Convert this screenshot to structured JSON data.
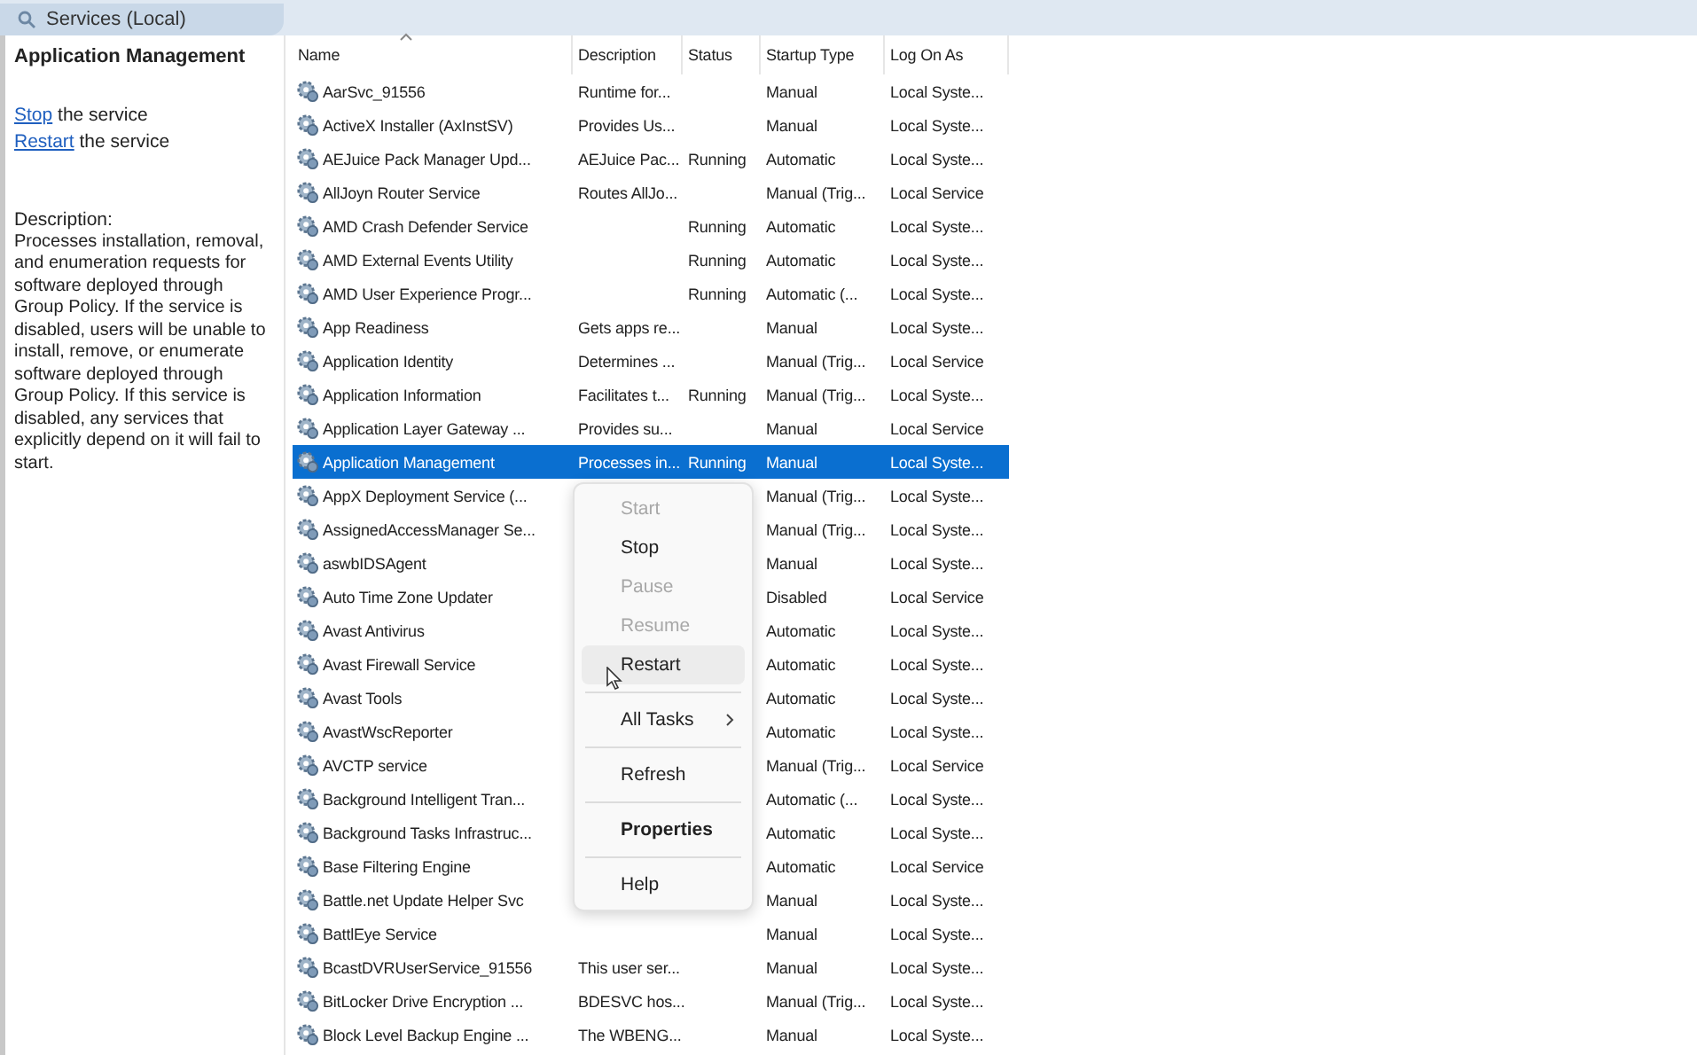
{
  "window": {
    "title": "Services (Local)"
  },
  "details": {
    "title": "Application Management",
    "actions": [
      {
        "link": "Stop",
        "text": "the service"
      },
      {
        "link": "Restart",
        "text": "the service"
      }
    ],
    "description_label": "Description:",
    "description": "Processes installation, removal, and enumeration requests for software deployed through Group Policy. If the service is disabled, users will be unable to install, remove, or enumerate software deployed through Group Policy. If this service is disabled, any services that explicitly depend on it will fail to start."
  },
  "table": {
    "columns": [
      {
        "label": "Name",
        "sorted": true
      },
      {
        "label": "Description",
        "sorted": false
      },
      {
        "label": "Status",
        "sorted": false
      },
      {
        "label": "Startup Type",
        "sorted": false
      },
      {
        "label": "Log On As",
        "sorted": false
      }
    ],
    "rows": [
      {
        "name": "AarSvc_91556",
        "description": "Runtime for...",
        "status": "",
        "startup_type": "Manual",
        "log_on_as": "Local Syste...",
        "selected": false
      },
      {
        "name": "ActiveX Installer (AxInstSV)",
        "description": "Provides Us...",
        "status": "",
        "startup_type": "Manual",
        "log_on_as": "Local Syste...",
        "selected": false
      },
      {
        "name": "AEJuice Pack Manager Upd...",
        "description": "AEJuice Pac...",
        "status": "Running",
        "startup_type": "Automatic",
        "log_on_as": "Local Syste...",
        "selected": false
      },
      {
        "name": "AllJoyn Router Service",
        "description": "Routes AllJo...",
        "status": "",
        "startup_type": "Manual (Trig...",
        "log_on_as": "Local Service",
        "selected": false
      },
      {
        "name": "AMD Crash Defender Service",
        "description": "",
        "status": "Running",
        "startup_type": "Automatic",
        "log_on_as": "Local Syste...",
        "selected": false
      },
      {
        "name": "AMD External Events Utility",
        "description": "",
        "status": "Running",
        "startup_type": "Automatic",
        "log_on_as": "Local Syste...",
        "selected": false
      },
      {
        "name": "AMD User Experience Progr...",
        "description": "",
        "status": "Running",
        "startup_type": "Automatic (...",
        "log_on_as": "Local Syste...",
        "selected": false
      },
      {
        "name": "App Readiness",
        "description": "Gets apps re...",
        "status": "",
        "startup_type": "Manual",
        "log_on_as": "Local Syste...",
        "selected": false
      },
      {
        "name": "Application Identity",
        "description": "Determines ...",
        "status": "",
        "startup_type": "Manual (Trig...",
        "log_on_as": "Local Service",
        "selected": false
      },
      {
        "name": "Application Information",
        "description": "Facilitates t...",
        "status": "Running",
        "startup_type": "Manual (Trig...",
        "log_on_as": "Local Syste...",
        "selected": false
      },
      {
        "name": "Application Layer Gateway ...",
        "description": "Provides su...",
        "status": "",
        "startup_type": "Manual",
        "log_on_as": "Local Service",
        "selected": false
      },
      {
        "name": "Application Management",
        "description": "Processes in...",
        "status": "Running",
        "startup_type": "Manual",
        "log_on_as": "Local Syste...",
        "selected": true
      },
      {
        "name": "AppX Deployment Service (...",
        "description": "",
        "status": "",
        "startup_type": "Manual (Trig...",
        "log_on_as": "Local Syste...",
        "selected": false
      },
      {
        "name": "AssignedAccessManager Se...",
        "description": "",
        "status": "",
        "startup_type": "Manual (Trig...",
        "log_on_as": "Local Syste...",
        "selected": false
      },
      {
        "name": "aswbIDSAgent",
        "description": "",
        "status": "",
        "startup_type": "Manual",
        "log_on_as": "Local Syste...",
        "selected": false
      },
      {
        "name": "Auto Time Zone Updater",
        "description": "",
        "status": "",
        "startup_type": "Disabled",
        "log_on_as": "Local Service",
        "selected": false
      },
      {
        "name": "Avast Antivirus",
        "description": "",
        "status": "",
        "startup_type": "Automatic",
        "log_on_as": "Local Syste...",
        "selected": false
      },
      {
        "name": "Avast Firewall Service",
        "description": "",
        "status": "",
        "startup_type": "Automatic",
        "log_on_as": "Local Syste...",
        "selected": false
      },
      {
        "name": "Avast Tools",
        "description": "",
        "status": "",
        "startup_type": "Automatic",
        "log_on_as": "Local Syste...",
        "selected": false
      },
      {
        "name": "AvastWscReporter",
        "description": "",
        "status": "",
        "startup_type": "Automatic",
        "log_on_as": "Local Syste...",
        "selected": false
      },
      {
        "name": "AVCTP service",
        "description": "",
        "status": "",
        "startup_type": "Manual (Trig...",
        "log_on_as": "Local Service",
        "selected": false
      },
      {
        "name": "Background Intelligent Tran...",
        "description": "",
        "status": "",
        "startup_type": "Automatic (...",
        "log_on_as": "Local Syste...",
        "selected": false
      },
      {
        "name": "Background Tasks Infrastruc...",
        "description": "",
        "status": "",
        "startup_type": "Automatic",
        "log_on_as": "Local Syste...",
        "selected": false
      },
      {
        "name": "Base Filtering Engine",
        "description": "",
        "status": "",
        "startup_type": "Automatic",
        "log_on_as": "Local Service",
        "selected": false
      },
      {
        "name": "Battle.net Update Helper Svc",
        "description": "",
        "status": "",
        "startup_type": "Manual",
        "log_on_as": "Local Syste...",
        "selected": false
      },
      {
        "name": "BattlEye Service",
        "description": "",
        "status": "",
        "startup_type": "Manual",
        "log_on_as": "Local Syste...",
        "selected": false
      },
      {
        "name": "BcastDVRUserService_91556",
        "description": "This user ser...",
        "status": "",
        "startup_type": "Manual",
        "log_on_as": "Local Syste...",
        "selected": false
      },
      {
        "name": "BitLocker Drive Encryption ...",
        "description": "BDESVC hos...",
        "status": "",
        "startup_type": "Manual (Trig...",
        "log_on_as": "Local Syste...",
        "selected": false
      },
      {
        "name": "Block Level Backup Engine ...",
        "description": "The WBENG...",
        "status": "",
        "startup_type": "Manual",
        "log_on_as": "Local Syste...",
        "selected": false
      }
    ]
  },
  "context_menu": {
    "items": [
      {
        "kind": "item",
        "label": "Start",
        "disabled": true,
        "hovered": false,
        "bold": false
      },
      {
        "kind": "item",
        "label": "Stop",
        "disabled": false,
        "hovered": false,
        "bold": false
      },
      {
        "kind": "item",
        "label": "Pause",
        "disabled": true,
        "hovered": false,
        "bold": false
      },
      {
        "kind": "item",
        "label": "Resume",
        "disabled": true,
        "hovered": false,
        "bold": false
      },
      {
        "kind": "item",
        "label": "Restart",
        "disabled": false,
        "hovered": true,
        "bold": false
      },
      {
        "kind": "separator"
      },
      {
        "kind": "submenu",
        "label": "All Tasks",
        "disabled": false,
        "hovered": false,
        "bold": false
      },
      {
        "kind": "separator"
      },
      {
        "kind": "item",
        "label": "Refresh",
        "disabled": false,
        "hovered": false,
        "bold": false
      },
      {
        "kind": "separator"
      },
      {
        "kind": "item",
        "label": "Properties",
        "disabled": false,
        "hovered": false,
        "bold": true
      },
      {
        "kind": "separator"
      },
      {
        "kind": "item",
        "label": "Help",
        "disabled": false,
        "hovered": false,
        "bold": false
      }
    ]
  }
}
